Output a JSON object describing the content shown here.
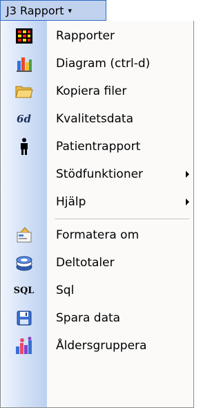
{
  "menu": {
    "title": "J3 Rapport",
    "items": [
      {
        "label": "Rapporter",
        "icon": "grid-report-icon",
        "submenu": false
      },
      {
        "label": "Diagram (ctrl-d)",
        "icon": "bar-chart-icon",
        "submenu": false
      },
      {
        "label": "Kopiera filer",
        "icon": "folder-icon",
        "submenu": false
      },
      {
        "label": "Kvalitetsdata",
        "icon": "quality-data-icon",
        "icon_text": "6d",
        "submenu": false
      },
      {
        "label": "Patientrapport",
        "icon": "person-icon",
        "submenu": false
      },
      {
        "label": "Stödfunktioner",
        "icon": "",
        "submenu": true
      },
      {
        "label": "Hjälp",
        "icon": "",
        "submenu": true
      },
      {
        "label": "Formatera om",
        "icon": "format-icon",
        "submenu": false
      },
      {
        "label": "Deltotaler",
        "icon": "stack-icon",
        "submenu": false
      },
      {
        "label": "Sql",
        "icon": "sql-icon",
        "icon_text": "SQL",
        "submenu": false
      },
      {
        "label": "Spara data",
        "icon": "save-icon",
        "submenu": false
      },
      {
        "label": "Åldersgruppera",
        "icon": "age-group-chart-icon",
        "submenu": false
      }
    ]
  }
}
